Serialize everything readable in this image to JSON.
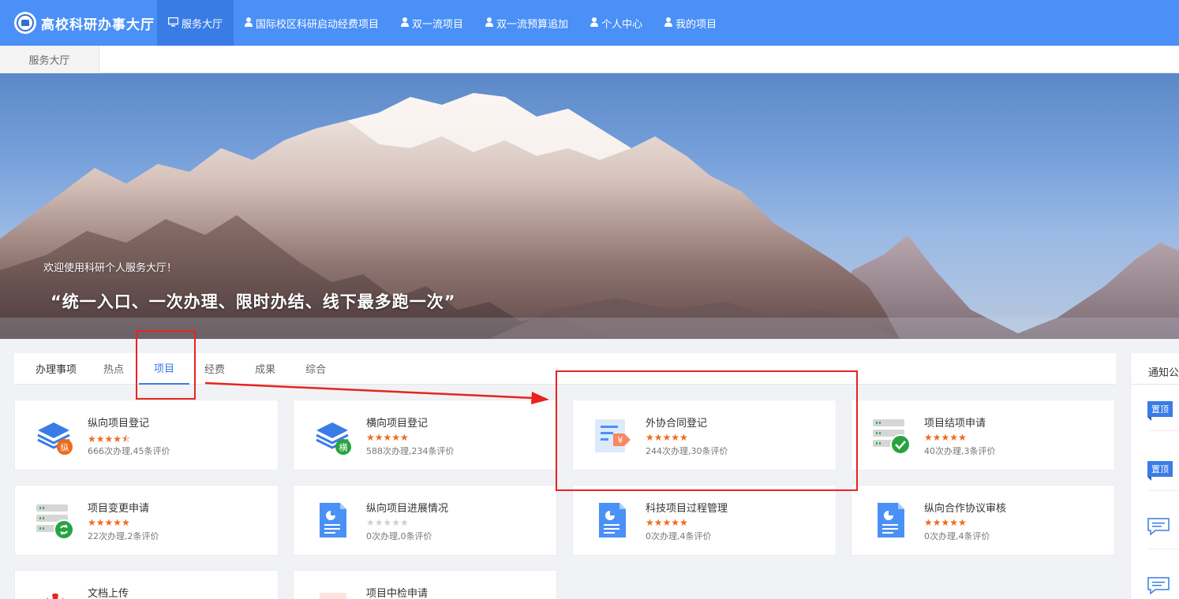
{
  "header": {
    "title": "高校科研办事大厅",
    "nav": [
      {
        "label": "服务大厅",
        "icon": "monitor-icon",
        "active": true
      },
      {
        "label": "国际校区科研启动经费项目",
        "icon": "user-icon"
      },
      {
        "label": "双一流项目",
        "icon": "user-icon"
      },
      {
        "label": "双一流预算追加",
        "icon": "user-icon"
      },
      {
        "label": "个人中心",
        "icon": "user-icon"
      },
      {
        "label": "我的项目",
        "icon": "user-icon"
      }
    ]
  },
  "breadcrumb": {
    "tab": "服务大厅"
  },
  "banner": {
    "welcome": "欢迎使用科研个人服务大厅！",
    "slogan": "“统一入口、一次办理、限时办结、线下最多跑一次”"
  },
  "tabs": {
    "lead": "办理事项",
    "items": [
      "热点",
      "项目",
      "经费",
      "成果",
      "综合"
    ],
    "active": "项目"
  },
  "cards": [
    {
      "title": "纵向项目登记",
      "rating": 4.5,
      "stars": "★★★★⯪",
      "meta": "666次办理,45条评价",
      "icon": "layers-vertical-icon"
    },
    {
      "title": "横向项目登记",
      "rating": 5,
      "stars": "★★★★★",
      "meta": "588次办理,234条评价",
      "icon": "layers-horizontal-icon"
    },
    {
      "title": "外协合同登记",
      "rating": 5,
      "stars": "★★★★★",
      "meta": "244次办理,30条评价",
      "icon": "contract-yuan-icon"
    },
    {
      "title": "项目结项申请",
      "rating": 5,
      "stars": "★★★★★",
      "meta": "40次办理,3条评价",
      "icon": "server-check-icon"
    },
    {
      "title": "项目变更申请",
      "rating": 5,
      "stars": "★★★★★",
      "meta": "22次办理,2条评价",
      "icon": "server-refresh-icon"
    },
    {
      "title": "纵向项目进展情况",
      "rating": 0,
      "stars": "★★★★★",
      "meta": "0次办理,0条评价",
      "icon": "document-chart-icon"
    },
    {
      "title": "科技项目过程管理",
      "rating": 5,
      "stars": "★★★★★",
      "meta": "0次办理,4条评价",
      "icon": "document-chart-icon"
    },
    {
      "title": "纵向合作协议审核",
      "rating": 5,
      "stars": "★★★★★",
      "meta": "0次办理,4条评价",
      "icon": "document-chart-icon"
    },
    {
      "title": "文档上传",
      "icon": "huawei-flower-icon"
    },
    {
      "title": "项目中检申请",
      "icon": "document-star-icon"
    }
  ],
  "notice": {
    "title": "通知公",
    "badges": [
      "置顶",
      "置顶"
    ]
  },
  "colors": {
    "brand": "#4a90f7",
    "nav_active": "#3a7ce6",
    "star": "#f06a1d",
    "annotation": "#e8231f"
  }
}
